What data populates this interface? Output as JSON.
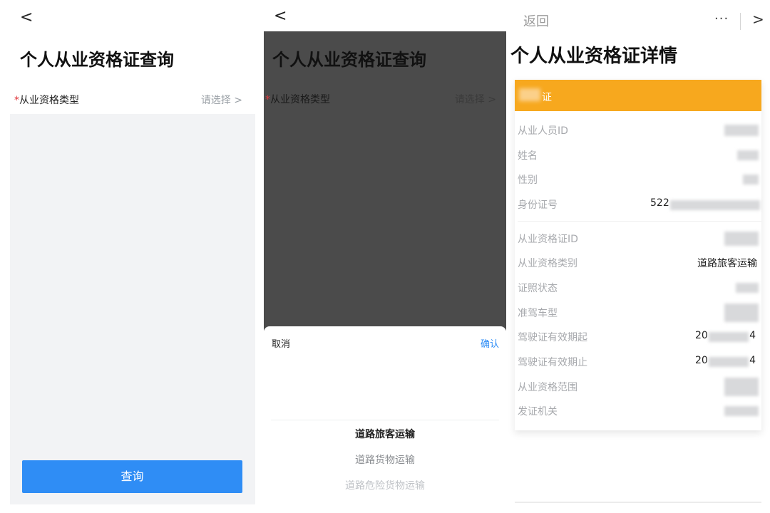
{
  "panel1": {
    "back_glyph": "<",
    "title": "个人从业资格证查询",
    "required_mark": "*",
    "field_label": "从业资格类型",
    "field_value": "请选择 >",
    "query_button": "查询"
  },
  "panel2": {
    "back_glyph": "<",
    "title": "个人从业资格证查询",
    "required_mark": "*",
    "field_label": "从业资格类型",
    "field_value": "请选择 >",
    "sheet": {
      "cancel": "取消",
      "confirm": "确认",
      "options": [
        "道路旅客运输",
        "道路货物运输",
        "道路危险货物运输"
      ]
    }
  },
  "panel3": {
    "nav_back": "返回",
    "nav_more": "···",
    "nav_close": ">",
    "title": "个人从业资格证详情",
    "banner_suffix": "证",
    "rows": [
      {
        "label": "从业人员ID",
        "value": ""
      },
      {
        "label": "姓名",
        "value": ""
      },
      {
        "label": "性别",
        "value": ""
      },
      {
        "label": "身份证号",
        "value": "522"
      },
      {
        "label": "从业资格证ID",
        "value": ""
      },
      {
        "label": "从业资格类别",
        "value": "道路旅客运输"
      },
      {
        "label": "证照状态",
        "value": ""
      },
      {
        "label": "准驾车型",
        "value": ""
      },
      {
        "label": "驾驶证有效期起",
        "value_prefix": "20",
        "value_suffix": "4"
      },
      {
        "label": "驾驶证有效期止",
        "value_prefix": "20",
        "value_suffix": "4"
      },
      {
        "label": "从业资格范围",
        "value": ""
      },
      {
        "label": "发证机关",
        "value": ""
      }
    ]
  },
  "colors": {
    "primary_blue": "#2f8df5",
    "banner_orange": "#f7a81e",
    "required_red": "#e0393e",
    "overlay_gray": "#4b4b4b"
  }
}
